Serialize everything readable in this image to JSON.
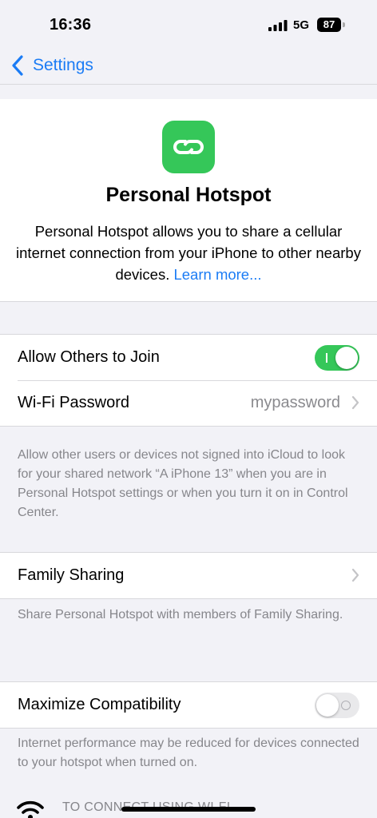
{
  "status_bar": {
    "time": "16:36",
    "network": "5G",
    "battery": "87"
  },
  "nav": {
    "back_label": "Settings"
  },
  "hero": {
    "icon": "link-icon",
    "title": "Personal Hotspot",
    "description": "Personal Hotspot allows you to share a cellular internet connection from your iPhone to other nearby devices.",
    "learn_more": "Learn more..."
  },
  "group1": {
    "allow_label": "Allow Others to Join",
    "allow_on": true,
    "wifi_password_label": "Wi-Fi Password",
    "wifi_password_value": "mypassword"
  },
  "group1_footer": "Allow other users or devices not signed into iCloud to look for your shared network “A iPhone 13” when you are in Personal Hotspot settings or when you turn it on in Control Center.",
  "family": {
    "label": "Family Sharing",
    "footer": "Share Personal Hotspot with members of Family Sharing."
  },
  "compat": {
    "label": "Maximize Compatibility",
    "on": false,
    "footer": "Internet performance may be reduced for devices connected to your hotspot when turned on."
  },
  "connect": {
    "heading": "TO CONNECT USING WI-FI"
  },
  "colors": {
    "accent": "#1b7cf5",
    "toggle_on": "#35c759",
    "secondary_text": "#86868b",
    "background": "#f2f2f7"
  }
}
